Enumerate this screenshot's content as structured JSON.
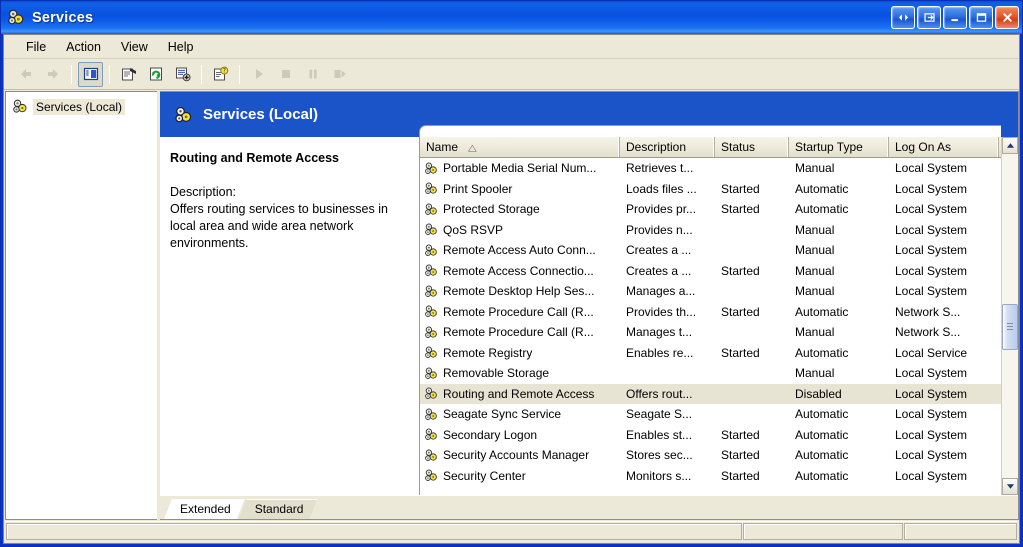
{
  "window": {
    "title": "Services",
    "icon": "services-gears-icon",
    "controls": [
      {
        "name": "restore-child-button",
        "glyph": "◀▶",
        "style": "blue"
      },
      {
        "name": "mdi-restore-button",
        "glyph": "⬒",
        "style": "blue"
      },
      {
        "name": "minimize-button",
        "glyph": "_",
        "style": "blue"
      },
      {
        "name": "maximize-button",
        "glyph": "☐",
        "style": "blue"
      },
      {
        "name": "close-button",
        "glyph": "✕",
        "style": "red"
      }
    ]
  },
  "menubar": {
    "items": [
      {
        "name": "menu-file",
        "label": "File"
      },
      {
        "name": "menu-action",
        "label": "Action"
      },
      {
        "name": "menu-view",
        "label": "View"
      },
      {
        "name": "menu-help",
        "label": "Help"
      }
    ]
  },
  "toolbar": {
    "buttons": [
      {
        "name": "back-button",
        "icon": "arrow-left-icon",
        "enabled": false,
        "pressed": false
      },
      {
        "name": "forward-button",
        "icon": "arrow-right-icon",
        "enabled": false,
        "pressed": false
      },
      {
        "name": "show-hide-tree-button",
        "icon": "show-console-tree-icon",
        "enabled": true,
        "pressed": true
      },
      {
        "name": "properties-button",
        "icon": "properties-icon",
        "enabled": true,
        "pressed": false
      },
      {
        "name": "refresh-button",
        "icon": "refresh-icon",
        "enabled": true,
        "pressed": false
      },
      {
        "name": "export-list-button",
        "icon": "export-list-icon",
        "enabled": true,
        "pressed": false
      },
      {
        "name": "help-button",
        "icon": "help-icon",
        "enabled": true,
        "pressed": false
      },
      {
        "name": "start-service-button",
        "icon": "play-icon",
        "enabled": false,
        "pressed": false
      },
      {
        "name": "stop-service-button",
        "icon": "stop-icon",
        "enabled": false,
        "pressed": false
      },
      {
        "name": "pause-service-button",
        "icon": "pause-icon",
        "enabled": false,
        "pressed": false
      },
      {
        "name": "restart-service-button",
        "icon": "restart-icon",
        "enabled": false,
        "pressed": false
      }
    ]
  },
  "tree": {
    "root": {
      "label": "Services (Local)",
      "icon": "services-gears-icon",
      "selected": true
    }
  },
  "main": {
    "header": {
      "title": "Services (Local)",
      "icon": "services-gears-icon"
    }
  },
  "details": {
    "service_name": "Routing and Remote Access",
    "description_label": "Description:",
    "description_text": "Offers routing services to businesses in local area and wide area network environments."
  },
  "list": {
    "columns": [
      {
        "name": "column-name",
        "label": "Name",
        "sorted": "asc",
        "sort_glyph": "△"
      },
      {
        "name": "column-description",
        "label": "Description",
        "sorted": "none",
        "sort_glyph": ""
      },
      {
        "name": "column-status",
        "label": "Status",
        "sorted": "none",
        "sort_glyph": ""
      },
      {
        "name": "column-startup-type",
        "label": "Startup Type",
        "sorted": "none",
        "sort_glyph": ""
      },
      {
        "name": "column-log-on-as",
        "label": "Log On As",
        "sorted": "none",
        "sort_glyph": ""
      }
    ],
    "rows": [
      {
        "name": "Portable Media Serial Num...",
        "description": "Retrieves t...",
        "status": "",
        "startup": "Manual",
        "logon": "Local System",
        "selected": false
      },
      {
        "name": "Print Spooler",
        "description": "Loads files ...",
        "status": "Started",
        "startup": "Automatic",
        "logon": "Local System",
        "selected": false
      },
      {
        "name": "Protected Storage",
        "description": "Provides pr...",
        "status": "Started",
        "startup": "Automatic",
        "logon": "Local System",
        "selected": false
      },
      {
        "name": "QoS RSVP",
        "description": "Provides n...",
        "status": "",
        "startup": "Manual",
        "logon": "Local System",
        "selected": false
      },
      {
        "name": "Remote Access Auto Conn...",
        "description": "Creates a ...",
        "status": "",
        "startup": "Manual",
        "logon": "Local System",
        "selected": false
      },
      {
        "name": "Remote Access Connectio...",
        "description": "Creates a ...",
        "status": "Started",
        "startup": "Manual",
        "logon": "Local System",
        "selected": false
      },
      {
        "name": "Remote Desktop Help Ses...",
        "description": "Manages a...",
        "status": "",
        "startup": "Manual",
        "logon": "Local System",
        "selected": false
      },
      {
        "name": "Remote Procedure Call (R...",
        "description": "Provides th...",
        "status": "Started",
        "startup": "Automatic",
        "logon": "Network S...",
        "selected": false
      },
      {
        "name": "Remote Procedure Call (R...",
        "description": "Manages t...",
        "status": "",
        "startup": "Manual",
        "logon": "Network S...",
        "selected": false
      },
      {
        "name": "Remote Registry",
        "description": "Enables re...",
        "status": "Started",
        "startup": "Automatic",
        "logon": "Local Service",
        "selected": false
      },
      {
        "name": "Removable Storage",
        "description": "",
        "status": "",
        "startup": "Manual",
        "logon": "Local System",
        "selected": false
      },
      {
        "name": "Routing and Remote Access",
        "description": "Offers rout...",
        "status": "",
        "startup": "Disabled",
        "logon": "Local System",
        "selected": true
      },
      {
        "name": "Seagate Sync Service",
        "description": "Seagate S...",
        "status": "",
        "startup": "Automatic",
        "logon": "Local System",
        "selected": false
      },
      {
        "name": "Secondary Logon",
        "description": "Enables st...",
        "status": "Started",
        "startup": "Automatic",
        "logon": "Local System",
        "selected": false
      },
      {
        "name": "Security Accounts Manager",
        "description": "Stores sec...",
        "status": "Started",
        "startup": "Automatic",
        "logon": "Local System",
        "selected": false
      },
      {
        "name": "Security Center",
        "description": "Monitors s...",
        "status": "Started",
        "startup": "Automatic",
        "logon": "Local System",
        "selected": false
      }
    ]
  },
  "scrollbar": {
    "up_glyph": "▲",
    "down_glyph": "▼"
  },
  "tabs": [
    {
      "name": "tab-extended",
      "label": "Extended",
      "active": true
    },
    {
      "name": "tab-standard",
      "label": "Standard",
      "active": false
    }
  ],
  "statusbar": {
    "pane1": "",
    "pane2": "",
    "pane3": ""
  },
  "colors": {
    "titlebar_blue": "#0a52e0",
    "mmc_header_blue": "#1a54c8",
    "chrome": "#ece9d8",
    "selection": "#e8e4d4"
  }
}
